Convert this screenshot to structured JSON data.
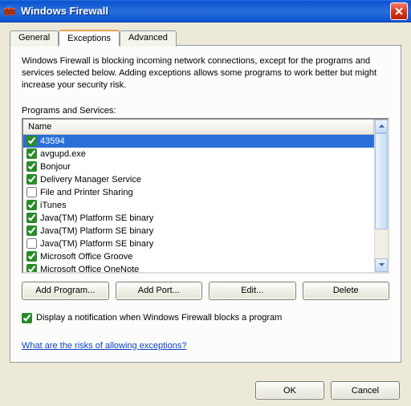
{
  "window": {
    "title": "Windows Firewall"
  },
  "tabs": {
    "general": "General",
    "exceptions": "Exceptions",
    "advanced": "Advanced"
  },
  "panel": {
    "description": "Windows Firewall is blocking incoming network connections, except for the programs and services selected below. Adding exceptions allows some programs to work better but might increase your security risk.",
    "list_label": "Programs and Services:",
    "column_header": "Name",
    "items": [
      {
        "label": "43594",
        "checked": true,
        "selected": true
      },
      {
        "label": "avgupd.exe",
        "checked": true,
        "selected": false
      },
      {
        "label": "Bonjour",
        "checked": true,
        "selected": false
      },
      {
        "label": "Delivery Manager Service",
        "checked": true,
        "selected": false
      },
      {
        "label": "File and Printer Sharing",
        "checked": false,
        "selected": false
      },
      {
        "label": "iTunes",
        "checked": true,
        "selected": false
      },
      {
        "label": "Java(TM) Platform SE binary",
        "checked": true,
        "selected": false
      },
      {
        "label": "Java(TM) Platform SE binary",
        "checked": true,
        "selected": false
      },
      {
        "label": "Java(TM) Platform SE binary",
        "checked": false,
        "selected": false
      },
      {
        "label": "Microsoft Office Groove",
        "checked": true,
        "selected": false
      },
      {
        "label": "Microsoft Office OneNote",
        "checked": true,
        "selected": false
      }
    ],
    "buttons": {
      "add_program": "Add Program...",
      "add_port": "Add Port...",
      "edit": "Edit...",
      "delete": "Delete"
    },
    "notify_label": "Display a notification when Windows Firewall blocks a program",
    "notify_checked": true,
    "help_link": "What are the risks of allowing exceptions?"
  },
  "dialog_buttons": {
    "ok": "OK",
    "cancel": "Cancel"
  }
}
